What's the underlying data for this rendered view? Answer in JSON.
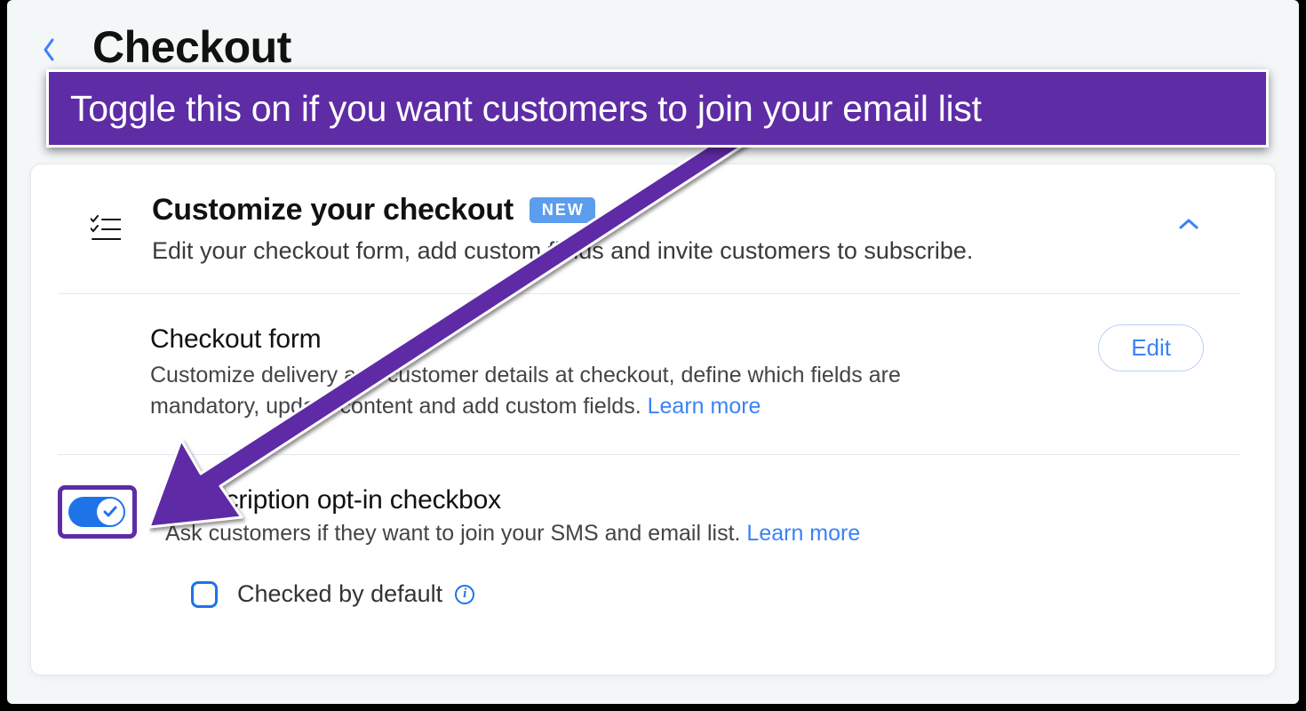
{
  "page": {
    "title": "Checkout"
  },
  "annotation": {
    "banner": "Toggle this on if you want customers to join your email list"
  },
  "customize": {
    "title": "Customize your checkout",
    "badge": "NEW",
    "subtitle": "Edit your checkout form, add custom fields and invite customers to subscribe."
  },
  "checkout_form": {
    "title": "Checkout form",
    "desc_part1": "Customize delivery and customer details at checkout, define which fields are mandatory, update content and add custom fields. ",
    "learn_more": "Learn more",
    "edit_label": "Edit"
  },
  "subscription": {
    "title": "Subscription opt-in checkbox",
    "desc_part1": "Ask customers if they want to join your SMS and email list. ",
    "learn_more": "Learn more",
    "checked_by_default": "Checked by default"
  },
  "colors": {
    "accent": "#5e2ca5",
    "link": "#3b82f6",
    "toggle": "#1e73e8"
  }
}
